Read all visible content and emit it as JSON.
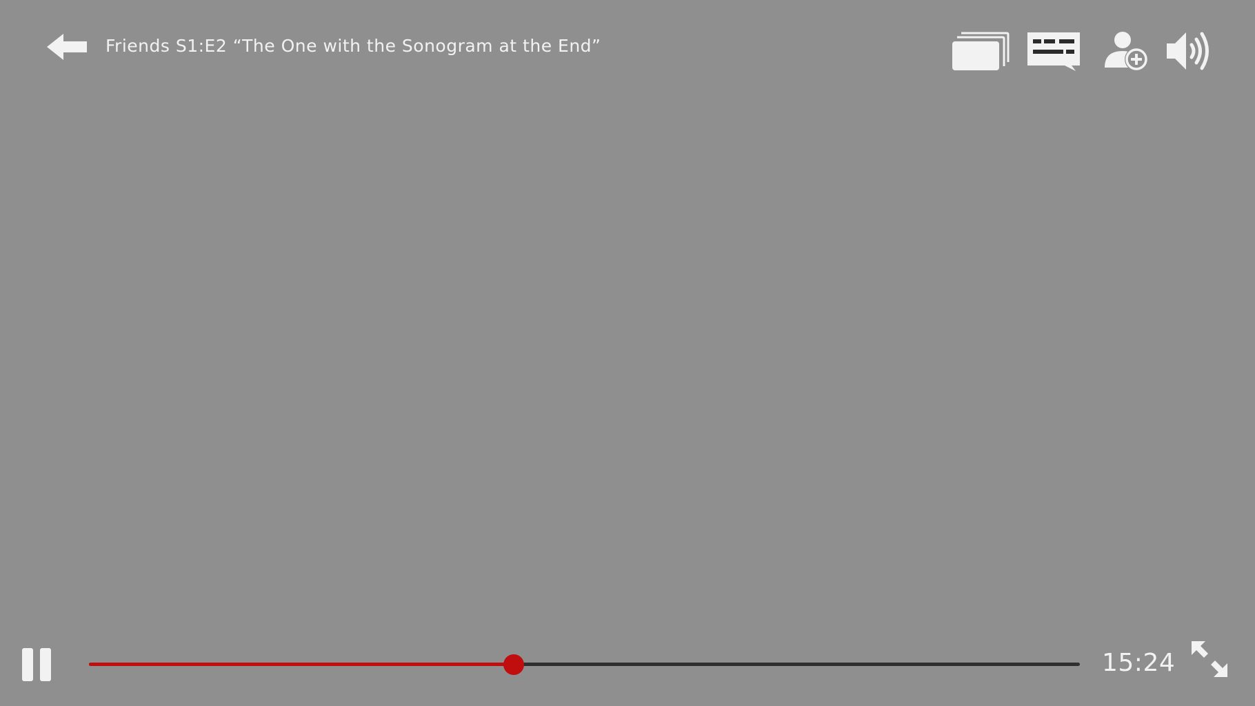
{
  "header": {
    "title": "Friends S1:E2 “The One with the Sonogram at the End”",
    "back_icon": "back-arrow-icon",
    "actions": [
      {
        "name": "episodes",
        "icon": "episodes-stack-icon"
      },
      {
        "name": "subtitles",
        "icon": "subtitles-icon"
      },
      {
        "name": "add-profile",
        "icon": "add-profile-icon"
      },
      {
        "name": "volume",
        "icon": "volume-icon"
      }
    ]
  },
  "controls": {
    "play_state_icon": "pause-icon",
    "progress_fraction": 0.429,
    "time_remaining": "15:24",
    "fullscreen_icon": "fullscreen-expand-icon"
  },
  "colors": {
    "background": "#8f8f8f",
    "accent": "#c00d0d",
    "track": "#2f2f2f",
    "icon": "#f2f2f2"
  }
}
